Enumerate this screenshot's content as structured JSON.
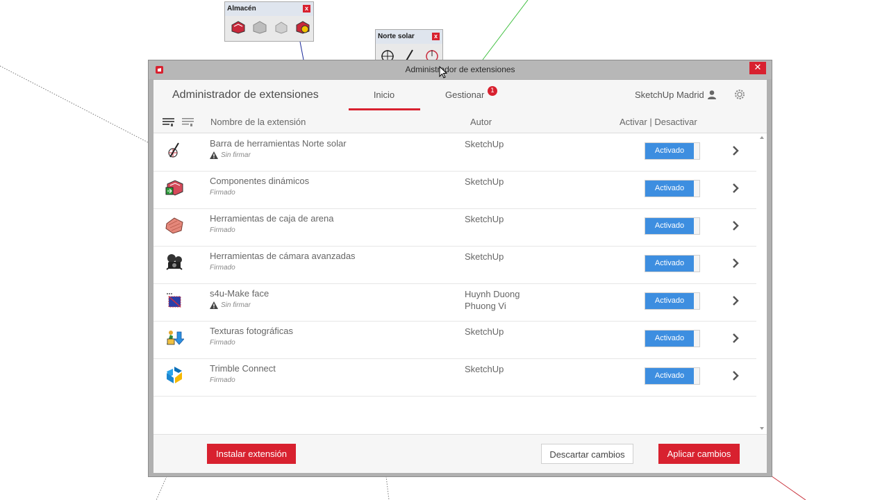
{
  "toolbars": {
    "almacen": {
      "title": "Almacén",
      "close": "x",
      "icons": [
        "warehouse-red-icon",
        "warehouse-gray-icon",
        "warehouse-gray2-icon",
        "warehouse-share-icon"
      ]
    },
    "norte_solar": {
      "title": "Norte solar",
      "close": "x",
      "icons": [
        "north-compass-icon",
        "north-arrow-icon",
        "north-red-compass-icon"
      ]
    }
  },
  "dialog": {
    "window_title": "Administrador de extensiones",
    "close_symbol": "✕",
    "header_title": "Administrador de extensiones",
    "tabs": [
      {
        "label": "Inicio",
        "active": true
      },
      {
        "label": "Gestionar",
        "badge": "1"
      }
    ],
    "user": "SketchUp Madrid",
    "columns": {
      "name": "Nombre de la extensión",
      "author": "Autor",
      "activate": "Activar | Desactivar"
    },
    "extensions": [
      {
        "name": "Barra de herramientas Norte solar",
        "signature": "Sin firmar",
        "unsigned": true,
        "author": [
          "SketchUp"
        ],
        "status": "Activado",
        "icon": "north-solar-icon"
      },
      {
        "name": "Componentes dinámicos",
        "signature": "Firmado",
        "unsigned": false,
        "author": [
          "SketchUp"
        ],
        "status": "Activado",
        "icon": "dynamic-components-icon"
      },
      {
        "name": "Herramientas de caja de arena",
        "signature": "Firmado",
        "unsigned": false,
        "author": [
          "SketchUp"
        ],
        "status": "Activado",
        "icon": "sandbox-icon"
      },
      {
        "name": "Herramientas de cámara avanzadas",
        "signature": "Firmado",
        "unsigned": false,
        "author": [
          "SketchUp"
        ],
        "status": "Activado",
        "icon": "camera-icon"
      },
      {
        "name": "s4u-Make face",
        "signature": "Sin firmar",
        "unsigned": true,
        "author": [
          "Huynh Duong",
          "Phuong Vi"
        ],
        "status": "Activado",
        "icon": "make-face-icon"
      },
      {
        "name": "Texturas fotográficas",
        "signature": "Firmado",
        "unsigned": false,
        "author": [
          "SketchUp"
        ],
        "status": "Activado",
        "icon": "photo-textures-icon"
      },
      {
        "name": "Trimble Connect",
        "signature": "Firmado",
        "unsigned": false,
        "author": [
          "SketchUp"
        ],
        "status": "Activado",
        "icon": "trimble-connect-icon"
      }
    ],
    "footer": {
      "install": "Instalar extensión",
      "discard": "Descartar cambios",
      "apply": "Aplicar cambios"
    }
  },
  "colors": {
    "accent": "#d8212f",
    "toggle_on": "#3d8ee0"
  }
}
